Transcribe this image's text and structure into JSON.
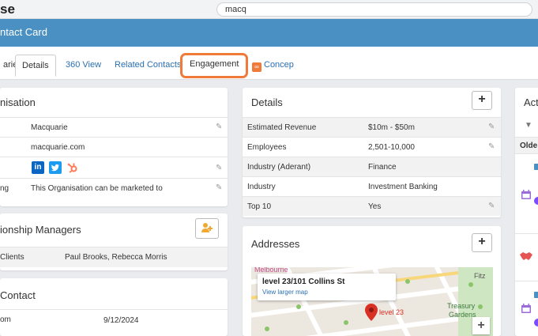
{
  "browser": {
    "app_fragment": "se",
    "search_value": "macq"
  },
  "header": {
    "title": "ntact Card"
  },
  "tabs": [
    {
      "label": "arie"
    },
    {
      "label": "Details"
    },
    {
      "label": "360 View"
    },
    {
      "label": "Related Contacts"
    },
    {
      "label": "Engagement"
    },
    {
      "label": "Concep",
      "icon": "concept-icon"
    }
  ],
  "org_card": {
    "title": "nisation",
    "rows": [
      {
        "label": "",
        "value": "Macquarie"
      },
      {
        "label": "",
        "value": "macquarie.com"
      },
      {
        "label": "",
        "value": ""
      },
      {
        "label": "ng",
        "value": "This Organisation can be marketed to"
      }
    ],
    "social_icons": [
      "linkedin-icon",
      "twitter-icon",
      "hubspot-icon"
    ]
  },
  "relationship_card": {
    "title": "ionship Managers",
    "row_label": "Clients",
    "row_value": "Paul Brooks, Rebecca Morris"
  },
  "contact_card": {
    "title": "Contact",
    "row_label": "om",
    "row_value": "9/12/2024"
  },
  "details_card": {
    "title": "Details",
    "rows": [
      {
        "label": "Estimated Revenue",
        "value": "$10m - $50m"
      },
      {
        "label": "Employees",
        "value": "2,501-10,000"
      },
      {
        "label": "Industry (Aderant)",
        "value": "Finance"
      },
      {
        "label": "Industry",
        "value": "Investment Banking"
      },
      {
        "label": "Top 10",
        "value": "Yes"
      }
    ]
  },
  "addresses_card": {
    "title": "Addresses",
    "map": {
      "address": "level 23/101 Collins St",
      "larger_map": "View larger map",
      "pin_label": "level 23",
      "area_top": "Melbourne",
      "area_right_1": "Treasury",
      "area_right_2": "Gardens",
      "area_right_top": "Fitz"
    }
  },
  "activity_card": {
    "title": "Act",
    "sort_label": "Olde"
  },
  "colors": {
    "header": "#4a90c2",
    "tab_highlight": "#ef7a3a",
    "link": "#2a6fb0"
  }
}
